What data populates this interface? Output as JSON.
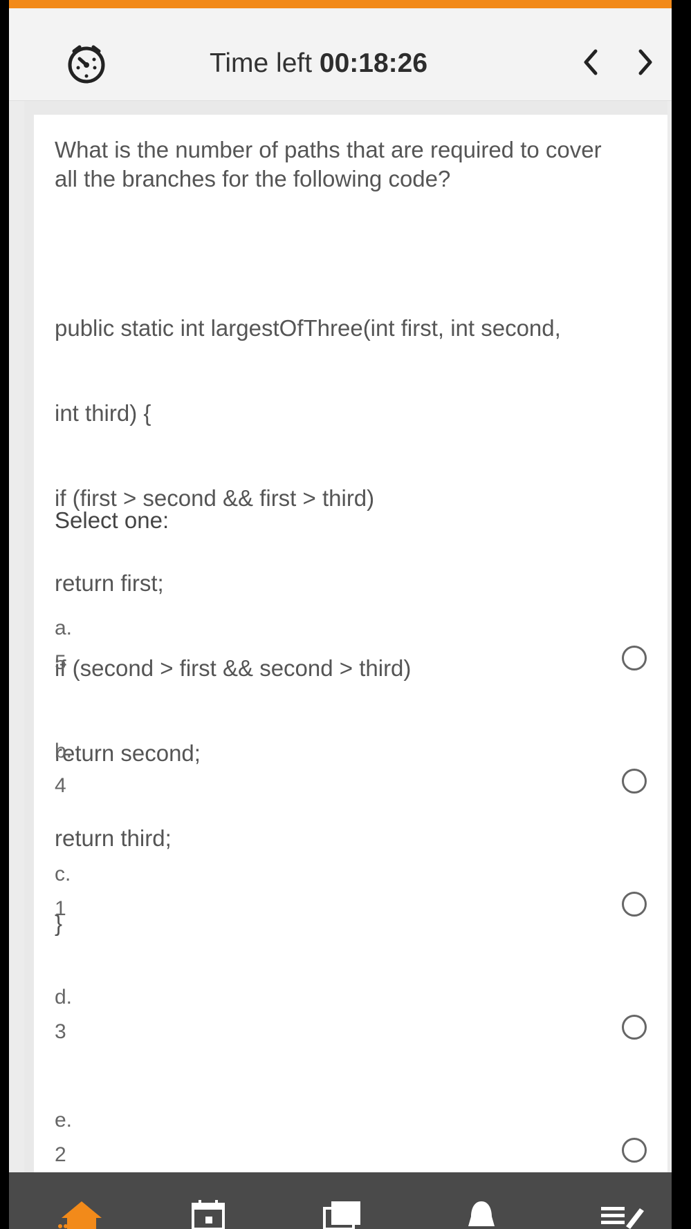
{
  "header": {
    "timer_label": "Time left",
    "timer_value": "00:18:26",
    "timer_icon": "timer-icon",
    "prev_icon": "chevron-left-icon",
    "next_icon": "chevron-right-icon"
  },
  "question": {
    "text": "What is the number of paths that are required to cover all the branches for the following code?",
    "code_lines": [
      "public static int largestOfThree(int first, int second,",
      "int third) {",
      "if (first > second && first > third)",
      "return first;",
      "if (second > first && second > third)",
      "return second;",
      "return third;",
      "}"
    ],
    "prompt": "Select one:"
  },
  "options": [
    {
      "letter": "a.",
      "value": "5",
      "selected": false
    },
    {
      "letter": "b.",
      "value": "4",
      "selected": false
    },
    {
      "letter": "c.",
      "value": "1",
      "selected": false
    },
    {
      "letter": "d.",
      "value": "3",
      "selected": false
    },
    {
      "letter": "e.",
      "value": "2",
      "selected": false
    }
  ],
  "bottom_nav": {
    "items": [
      "home-icon",
      "calendar-icon",
      "courses-icon",
      "notifications-icon",
      "menu-icon"
    ],
    "active": "home-icon"
  },
  "colors": {
    "accent": "#f28a1a",
    "bottom_bar": "#4a4a4a",
    "text": "#555555"
  }
}
